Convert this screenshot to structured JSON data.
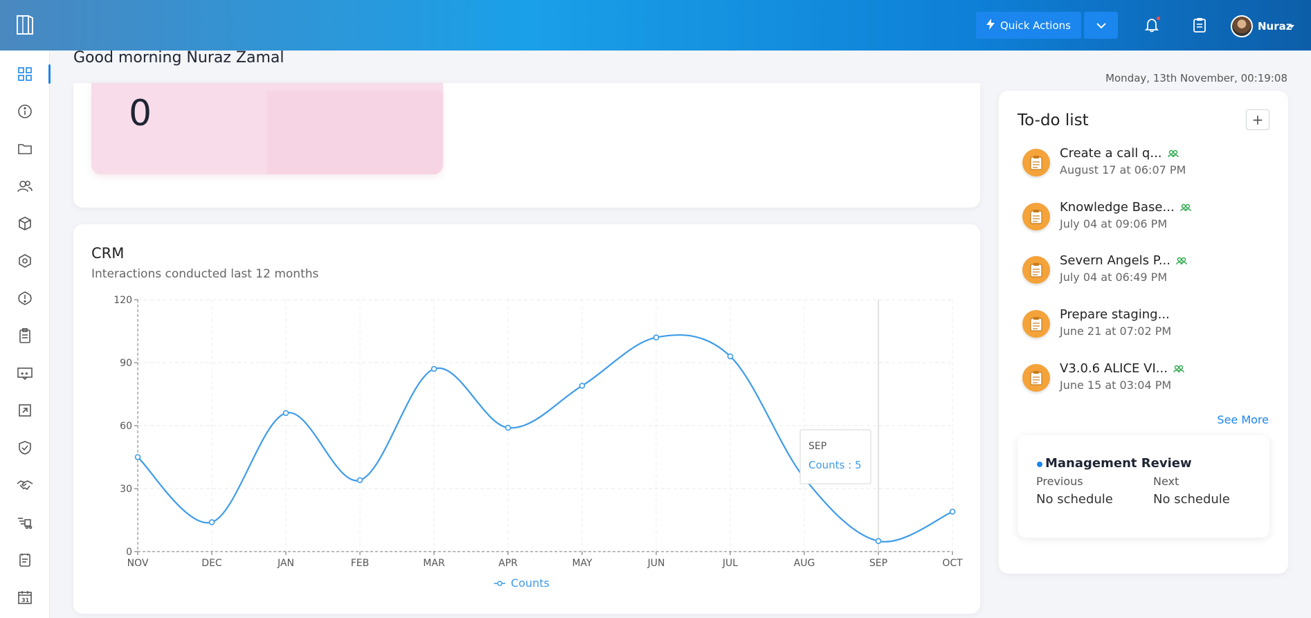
{
  "header": {
    "quick_actions_label": "Quick Actions",
    "user_name": "Nuraz"
  },
  "greeting": "Good morning Nuraz Zamal",
  "datetime": "Monday, 13th November, 00:19:08",
  "stat_card": {
    "value": "0"
  },
  "crm": {
    "title": "CRM",
    "subtitle": "Interactions conducted last 12 months"
  },
  "chart_data": {
    "type": "line",
    "categories": [
      "NOV",
      "DEC",
      "JAN",
      "FEB",
      "MAR",
      "APR",
      "MAY",
      "JUN",
      "JUL",
      "AUG",
      "SEP",
      "OCT"
    ],
    "series": [
      {
        "name": "Counts",
        "values": [
          45,
          14,
          66,
          34,
          87,
          59,
          79,
          102,
          93,
          35,
          5,
          19
        ]
      }
    ],
    "yticks": [
      0,
      30,
      60,
      90,
      120
    ],
    "ylim": [
      0,
      120
    ],
    "grid": true,
    "legend": "bottom",
    "tooltip": {
      "category": "SEP",
      "label": "Counts : 5"
    },
    "color": "#3d9be9"
  },
  "todo": {
    "title": "To-do list",
    "add_label": "+",
    "items": [
      {
        "name": "Create a call q...",
        "date": "August 17 at 06:07 PM",
        "shared": true
      },
      {
        "name": "Knowledge Base...",
        "date": "July 04 at 09:06 PM",
        "shared": true
      },
      {
        "name": "Severn Angels P...",
        "date": "July 04 at 06:49 PM",
        "shared": true
      },
      {
        "name": "Prepare staging...",
        "date": "June 21 at 07:02 PM",
        "shared": false
      },
      {
        "name": "V3.0.6 ALICE VI...",
        "date": "June 15 at 03:04 PM",
        "shared": true
      }
    ],
    "see_more": "See More"
  },
  "management_review": {
    "title": "Management Review",
    "previous_label": "Previous",
    "previous_value": "No schedule",
    "next_label": "Next",
    "next_value": "No schedule"
  },
  "sidebar": {
    "icons": [
      "dashboard-icon",
      "info-icon",
      "folder-icon",
      "users-icon",
      "box-icon",
      "settings-hex-icon",
      "alert-icon",
      "clipboard-icon",
      "stars-card-icon",
      "external-link-icon",
      "shield-check-icon",
      "handshake-icon",
      "delivery-icon",
      "checklist-icon",
      "calendar-icon"
    ]
  }
}
